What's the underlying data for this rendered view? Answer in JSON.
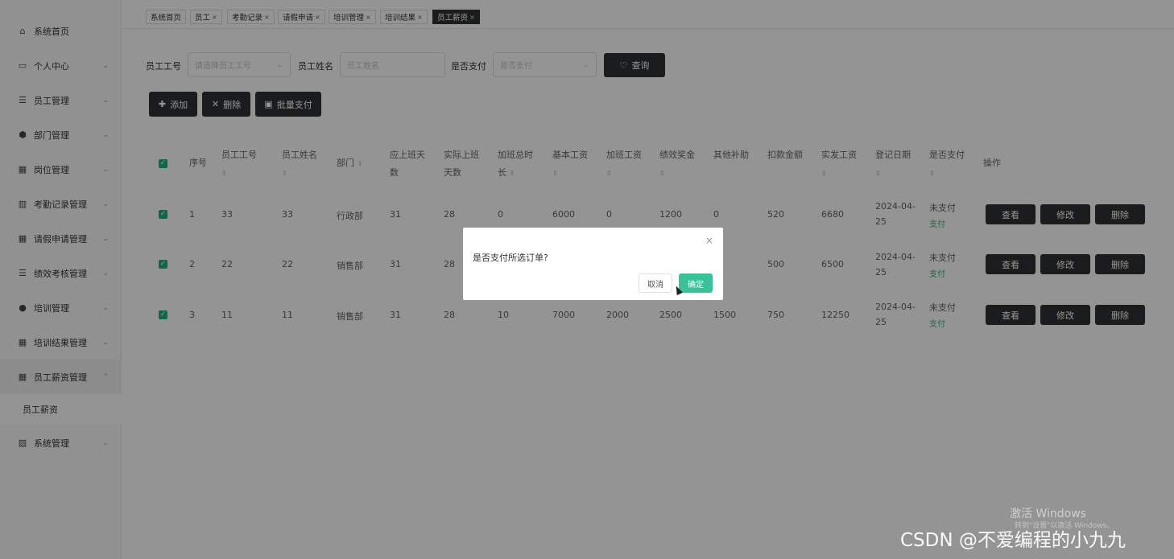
{
  "sidebar": {
    "items": [
      {
        "label": "系统首页",
        "icon": "home-icon",
        "glyph": "⌂"
      },
      {
        "label": "个人中心",
        "icon": "id-card-icon",
        "glyph": "▭"
      },
      {
        "label": "员工管理",
        "icon": "list-icon",
        "glyph": "☰"
      },
      {
        "label": "部门管理",
        "icon": "shield-icon",
        "glyph": "⬢"
      },
      {
        "label": "岗位管理",
        "icon": "grid-icon",
        "glyph": "▦"
      },
      {
        "label": "考勤记录管理",
        "icon": "chart-icon",
        "glyph": "▥"
      },
      {
        "label": "请假申请管理",
        "icon": "grid-icon",
        "glyph": "▦"
      },
      {
        "label": "绩效考核管理",
        "icon": "list-icon",
        "glyph": "☰"
      },
      {
        "label": "培训管理",
        "icon": "user-icon",
        "glyph": "●"
      },
      {
        "label": "培训结果管理",
        "icon": "grid-icon",
        "glyph": "▦"
      },
      {
        "label": "员工薪资管理",
        "icon": "grid-icon",
        "glyph": "▦"
      },
      {
        "label": "系统管理",
        "icon": "settings-icon",
        "glyph": "▨"
      }
    ],
    "subitem": "员工薪资"
  },
  "tabs": [
    {
      "label": "系统首页",
      "closable": false
    },
    {
      "label": "员工",
      "closable": true
    },
    {
      "label": "考勤记录",
      "closable": true
    },
    {
      "label": "请假申请",
      "closable": true
    },
    {
      "label": "培训管理",
      "closable": true
    },
    {
      "label": "培训结果",
      "closable": true
    },
    {
      "label": "员工薪资",
      "closable": true
    }
  ],
  "search": {
    "emp_no_label": "员工工号",
    "emp_no_placeholder": "请选择员工工号",
    "emp_name_label": "员工姓名",
    "emp_name_placeholder": "员工姓名",
    "paid_label": "是否支付",
    "paid_placeholder": "是否支付",
    "query_label": "查询"
  },
  "toolbar": {
    "add_label": "添加",
    "delete_label": "删除",
    "batch_pay_label": "批量支付"
  },
  "table": {
    "headers": [
      "序号",
      "员工工号",
      "员工姓名",
      "部门",
      "应上班天数",
      "实际上班天数",
      "加班总时长",
      "基本工资",
      "加班工资",
      "绩效奖金",
      "其他补助",
      "扣款金额",
      "实发工资",
      "登记日期",
      "是否支付",
      "操作"
    ],
    "rows": [
      {
        "idx": "1",
        "emp_no": "33",
        "emp_name": "33",
        "dept": "行政部",
        "due": "31",
        "actual": "28",
        "ot": "0",
        "base": "6000",
        "ot_pay": "0",
        "bonus": "1200",
        "other": "0",
        "deduct": "520",
        "net": "6680",
        "date1": "2024-04-",
        "date2": "25",
        "status": "未支付",
        "pay": "支付"
      },
      {
        "idx": "2",
        "emp_no": "22",
        "emp_name": "22",
        "dept": "销售部",
        "due": "31",
        "actual": "28",
        "ot": "",
        "base": "",
        "ot_pay": "",
        "bonus": "",
        "other": "",
        "deduct": "500",
        "net": "6500",
        "date1": "2024-04-",
        "date2": "25",
        "status": "未支付",
        "pay": "支付"
      },
      {
        "idx": "3",
        "emp_no": "11",
        "emp_name": "11",
        "dept": "销售部",
        "due": "31",
        "actual": "28",
        "ot": "10",
        "base": "7000",
        "ot_pay": "2000",
        "bonus": "2500",
        "other": "1500",
        "deduct": "750",
        "net": "12250",
        "date1": "2024-04-",
        "date2": "25",
        "status": "未支付",
        "pay": "支付"
      }
    ],
    "actions": {
      "view": "查看",
      "edit": "修改",
      "delete": "删除"
    }
  },
  "dialog": {
    "message": "是否支付所选订单?",
    "cancel_label": "取消",
    "confirm_label": "确定",
    "close_glyph": "×"
  },
  "watermarks": {
    "windows_line1": "激活 Windows",
    "windows_line2": "转到\"设置\"以激活 Windows。",
    "csdn": "CSDN @不爱编程的小九九"
  }
}
